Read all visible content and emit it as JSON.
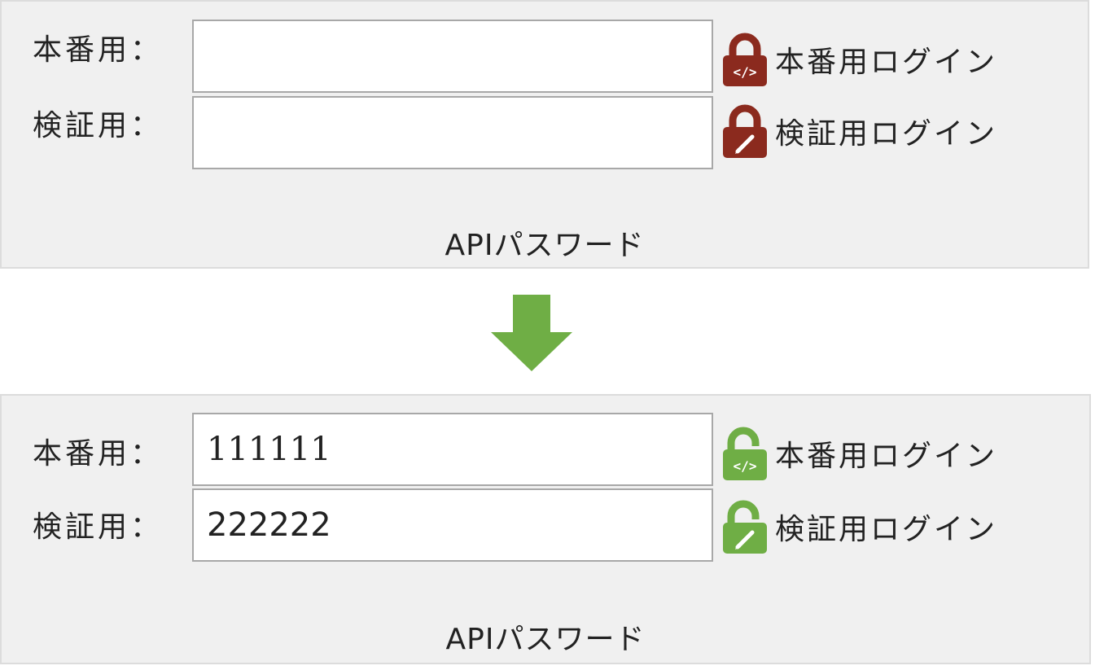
{
  "colors": {
    "locked": "#8b2a1e",
    "unlocked": "#6fae45",
    "arrow": "#6fae45",
    "panel_bg": "#f0f0f0"
  },
  "before": {
    "rows": [
      {
        "label": "本番用：",
        "value": "",
        "login_label": "本番用ログイン",
        "icon": "lock-code-icon"
      },
      {
        "label": "検証用：",
        "value": "",
        "login_label": "検証用ログイン",
        "icon": "lock-pencil-icon"
      }
    ],
    "caption": "APIパスワード"
  },
  "arrow": {
    "icon": "arrow-down-icon"
  },
  "after": {
    "rows": [
      {
        "label": "本番用：",
        "value": "111111",
        "login_label": "本番用ログイン",
        "icon": "unlock-code-icon"
      },
      {
        "label": "検証用：",
        "value": "222222",
        "login_label": "検証用ログイン",
        "icon": "unlock-pencil-icon"
      }
    ],
    "caption": "APIパスワード"
  }
}
